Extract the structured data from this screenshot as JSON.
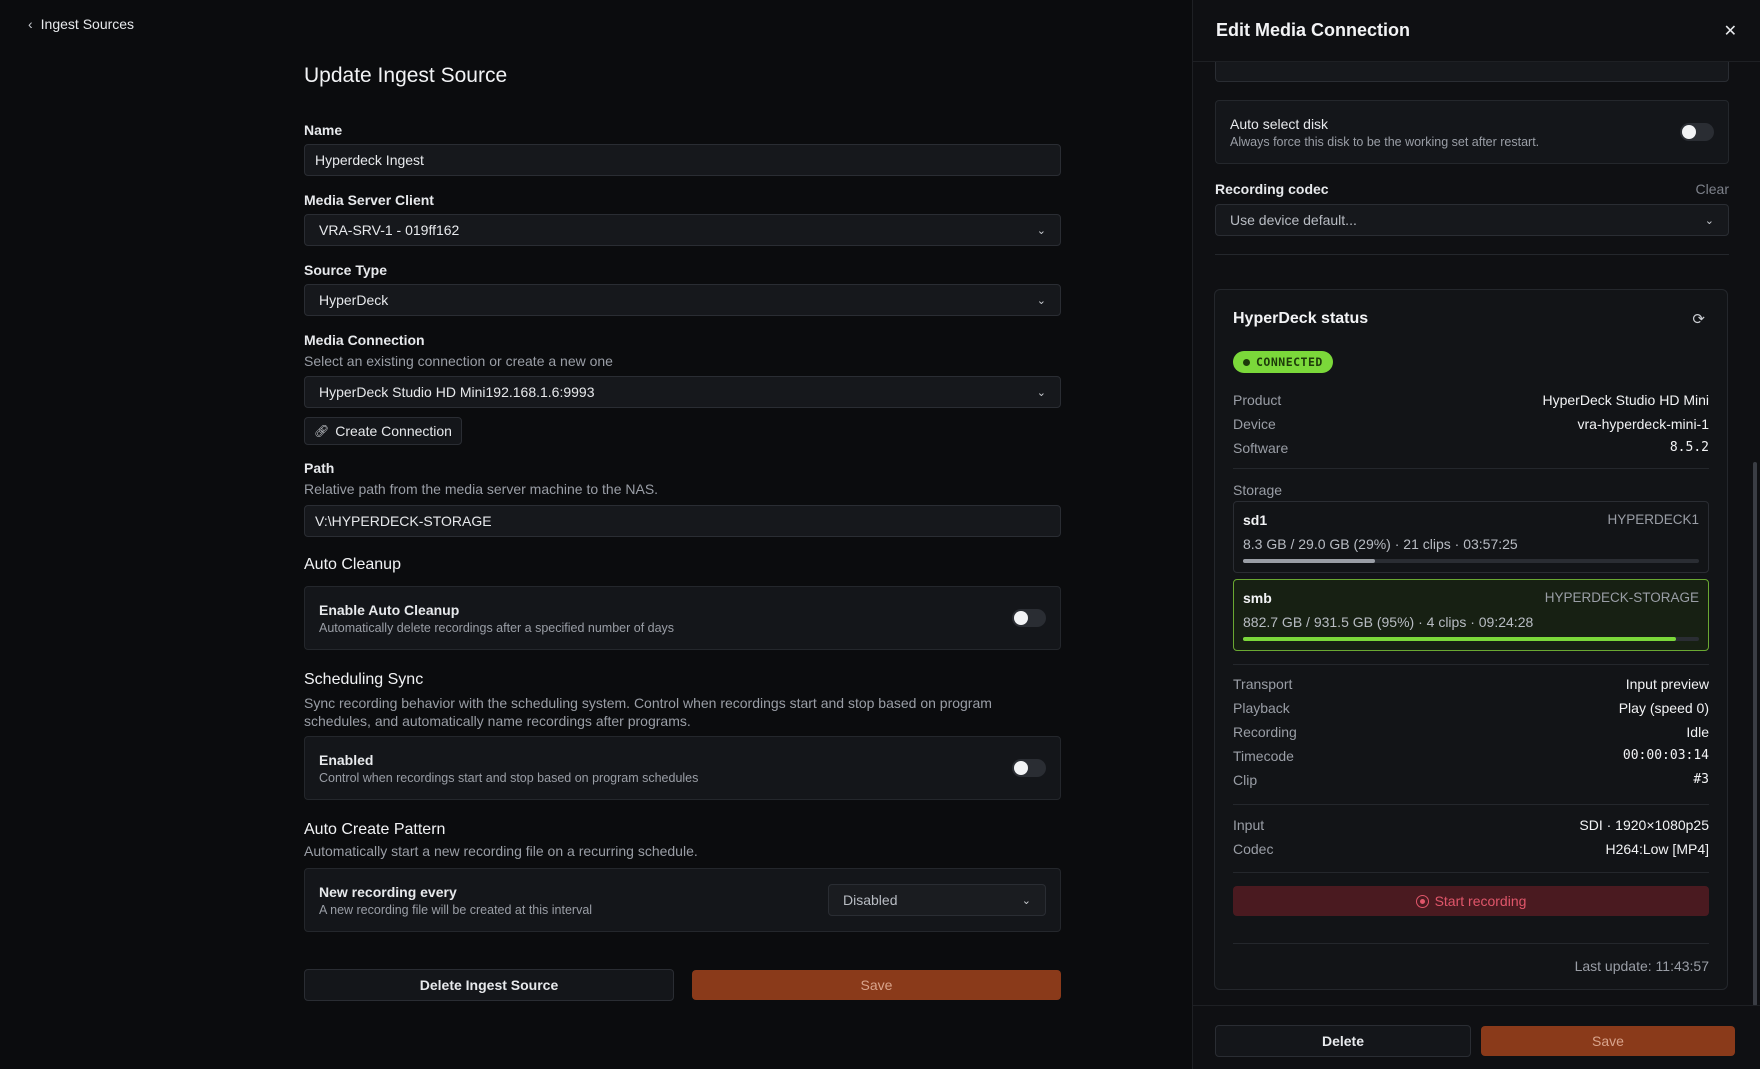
{
  "nav": {
    "back_label": "Ingest Sources"
  },
  "form": {
    "title": "Update Ingest Source",
    "name_label": "Name",
    "name_value": "Hyperdeck Ingest",
    "client_label": "Media Server Client",
    "client_value": "VRA-SRV-1 - 019ff162",
    "source_type_label": "Source Type",
    "source_type_value": "HyperDeck",
    "connection_label": "Media Connection",
    "connection_hint": "Select an existing connection or create a new one",
    "connection_value": "HyperDeck Studio HD Mini192.168.1.6:9993",
    "create_connection_label": "Create Connection",
    "path_label": "Path",
    "path_hint": "Relative path from the media server machine to the NAS.",
    "path_value": "V:\\HYPERDECK-STORAGE",
    "auto_cleanup_title": "Auto Cleanup",
    "auto_cleanup_card_title": "Enable Auto Cleanup",
    "auto_cleanup_card_desc": "Automatically delete recordings after a specified number of days",
    "auto_cleanup_enabled": false,
    "sched_title": "Scheduling Sync",
    "sched_desc": "Sync recording behavior with the scheduling system. Control when recordings start and stop based on program schedules, and automatically name recordings after programs.",
    "sched_card_title": "Enabled",
    "sched_card_desc": "Control when recordings start and stop based on program schedules",
    "sched_enabled": false,
    "pattern_title": "Auto Create Pattern",
    "pattern_desc": "Automatically start a new recording file on a recurring schedule.",
    "pattern_card_title": "New recording every",
    "pattern_card_desc": "A new recording file will be created at this interval",
    "pattern_value": "Disabled",
    "delete_label": "Delete Ingest Source",
    "save_label": "Save"
  },
  "panel": {
    "title": "Edit Media Connection",
    "close_icon": "close-icon",
    "auto_disk_title": "Auto select disk",
    "auto_disk_desc": "Always force this disk to be the working set after restart.",
    "auto_disk_enabled": false,
    "codec_label": "Recording codec",
    "codec_clear": "Clear",
    "codec_placeholder": "Use device default...",
    "status": {
      "title": "HyperDeck status",
      "badge": "CONNECTED",
      "product_k": "Product",
      "product_v": "HyperDeck Studio HD Mini",
      "device_k": "Device",
      "device_v": "vra-hyperdeck-mini-1",
      "software_k": "Software",
      "software_v": "8.5.2",
      "storage_label": "Storage",
      "disks": [
        {
          "name": "sd1",
          "label": "HYPERDECK1",
          "info": "8.3 GB / 29.0 GB (29%) · 21 clips · 03:57:25",
          "usage": 0.29
        },
        {
          "name": "smb",
          "label": "HYPERDECK-STORAGE",
          "info": "882.7 GB / 931.5 GB (95%) · 4 clips · 09:24:28",
          "usage": 0.95
        }
      ],
      "transport_k": "Transport",
      "transport_v": "Input preview",
      "playback_k": "Playback",
      "playback_v": "Play (speed 0)",
      "recording_k": "Recording",
      "recording_v": "Idle",
      "timecode_k": "Timecode",
      "timecode_v": "00:00:03:14",
      "clip_k": "Clip",
      "clip_v": "#3",
      "input_k": "Input",
      "input_v": "SDI · 1920×1080p25",
      "codec_k": "Codec",
      "codec_v": "H264:Low [MP4]",
      "start_recording_label": "Start recording",
      "last_update": "Last update: 11:43:57"
    },
    "delete_label": "Delete",
    "save_label": "Save"
  },
  "colors": {
    "accent_save": "#8a3a1a",
    "connected_green": "#7bd83a",
    "danger": "#e0566a",
    "storage_bar": "#7bd83a"
  }
}
